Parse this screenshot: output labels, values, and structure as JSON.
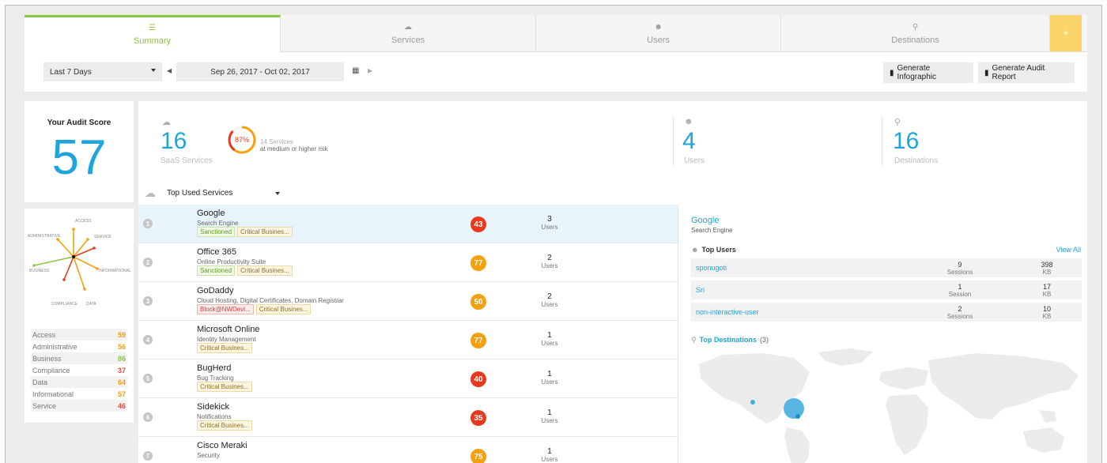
{
  "tabs": [
    {
      "label": "Summary",
      "icon": "list-icon",
      "active": true
    },
    {
      "label": "Services",
      "icon": "cloud-icon",
      "active": false
    },
    {
      "label": "Users",
      "icon": "users-icon",
      "active": false
    },
    {
      "label": "Destinations",
      "icon": "pin-icon",
      "active": false
    }
  ],
  "toolbar": {
    "period": "Last 7 Days",
    "date_range": "Sep 26, 2017 - Oct 02, 2017",
    "infographic_label": "Generate Infographic",
    "audit_label": "Generate Audit Report"
  },
  "score": {
    "title": "Your Audit Score",
    "value": "57",
    "radar_labels": [
      "ACCESS",
      "SERVICE",
      "INFORMATIONAL",
      "DATA",
      "COMPLIANCE",
      "BUSINESS",
      "ADMINISTRATIVE"
    ],
    "metrics": [
      {
        "label": "Access",
        "value": "59",
        "color": "#f39c12"
      },
      {
        "label": "Administrative",
        "value": "56",
        "color": "#f39c12"
      },
      {
        "label": "Business",
        "value": "86",
        "color": "#8dc63f"
      },
      {
        "label": "Compliance",
        "value": "37",
        "color": "#e74c3c"
      },
      {
        "label": "Data",
        "value": "64",
        "color": "#f39c12"
      },
      {
        "label": "Informational",
        "value": "57",
        "color": "#f39c12"
      },
      {
        "label": "Service",
        "value": "46",
        "color": "#e74c3c"
      }
    ]
  },
  "summary": {
    "saas_count": "16",
    "saas_label": "SaaS Services",
    "risk_percent": "87%",
    "risk_line1": "14 Services",
    "risk_line2": "at medium or higher risk",
    "users_count": "4",
    "users_label": "Users",
    "dest_count": "16",
    "dest_label": "Destinations",
    "top_used_label": "Top Used Services"
  },
  "services": [
    {
      "num": "1",
      "name": "Google",
      "category": "Search Engine",
      "tags": [
        {
          "text": "Sanctioned",
          "kind": "green"
        },
        {
          "text": "Critical Busines...",
          "kind": "amber"
        }
      ],
      "risk": "43",
      "risk_color": "#e8391e",
      "users": "3",
      "users_label": "Users"
    },
    {
      "num": "2",
      "name": "Office 365",
      "category": "Online Productivity Suite",
      "tags": [
        {
          "text": "Sanctioned",
          "kind": "green"
        },
        {
          "text": "Critical Busines...",
          "kind": "amber"
        }
      ],
      "risk": "77",
      "risk_color": "#f5a00f",
      "users": "2",
      "users_label": "Users"
    },
    {
      "num": "3",
      "name": "GoDaddy",
      "category": "Cloud Hosting, Digital Certificates, Domain Registrar",
      "tags": [
        {
          "text": "Block@NWDevi...",
          "kind": "red"
        },
        {
          "text": "Critical Busines...",
          "kind": "amber"
        }
      ],
      "risk": "50",
      "risk_color": "#f5a00f",
      "users": "2",
      "users_label": "Users"
    },
    {
      "num": "4",
      "name": "Microsoft Online",
      "category": "Identity Management",
      "tags": [
        {
          "text": "Critical Busines...",
          "kind": "amber"
        }
      ],
      "risk": "77",
      "risk_color": "#f5a00f",
      "users": "1",
      "users_label": "Users"
    },
    {
      "num": "5",
      "name": "BugHerd",
      "category": "Bug Tracking",
      "tags": [
        {
          "text": "Critical Busines...",
          "kind": "amber"
        }
      ],
      "risk": "40",
      "risk_color": "#e8391e",
      "users": "1",
      "users_label": "Users"
    },
    {
      "num": "6",
      "name": "Sidekick",
      "category": "Notifications",
      "tags": [
        {
          "text": "Critical Busines...",
          "kind": "amber"
        }
      ],
      "risk": "35",
      "risk_color": "#e8391e",
      "users": "1",
      "users_label": "Users"
    },
    {
      "num": "7",
      "name": "Cisco Meraki",
      "category": "Security",
      "tags": [],
      "risk": "75",
      "risk_color": "#f5a00f",
      "users": "1",
      "users_label": "Users"
    }
  ],
  "detail": {
    "title": "Google",
    "subtitle": "Search Engine",
    "top_users_label": "Top Users",
    "view_all": "View All",
    "users": [
      {
        "name": "sponugoti",
        "sessions": "9",
        "sessions_label": "Sessions",
        "kb": "398",
        "kb_label": "KB"
      },
      {
        "name": "Sri",
        "sessions": "1",
        "sessions_label": "Session",
        "kb": "17",
        "kb_label": "KB"
      },
      {
        "name": "non-interactive-user",
        "sessions": "2",
        "sessions_label": "Sessions",
        "kb": "10",
        "kb_label": "KB"
      }
    ],
    "top_destinations_label": "Top Destinations",
    "top_destinations_count": "(3)"
  },
  "colors": {
    "accent_blue": "#1ea5dc",
    "accent_green": "#8dc63f",
    "flag_yellow": "#fbd56a"
  }
}
